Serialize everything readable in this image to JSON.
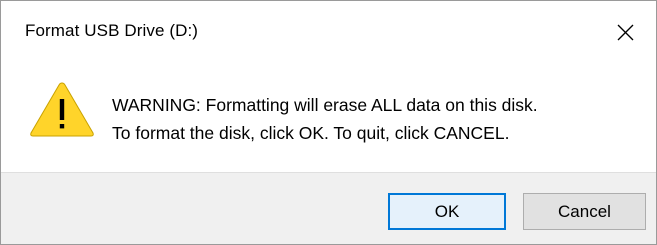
{
  "window": {
    "title": "Format USB Drive (D:)"
  },
  "icons": {
    "close": "close-icon",
    "warning": "warning-icon"
  },
  "message": {
    "line1": "WARNING: Formatting will erase ALL data on this disk.",
    "line2": "To format the disk, click OK. To quit, click CANCEL."
  },
  "buttons": {
    "ok_label": "OK",
    "cancel_label": "Cancel"
  },
  "colors": {
    "warning_fill": "#ffd42a",
    "focus_border": "#0078d7",
    "footer_bg": "#f0f0f0"
  }
}
